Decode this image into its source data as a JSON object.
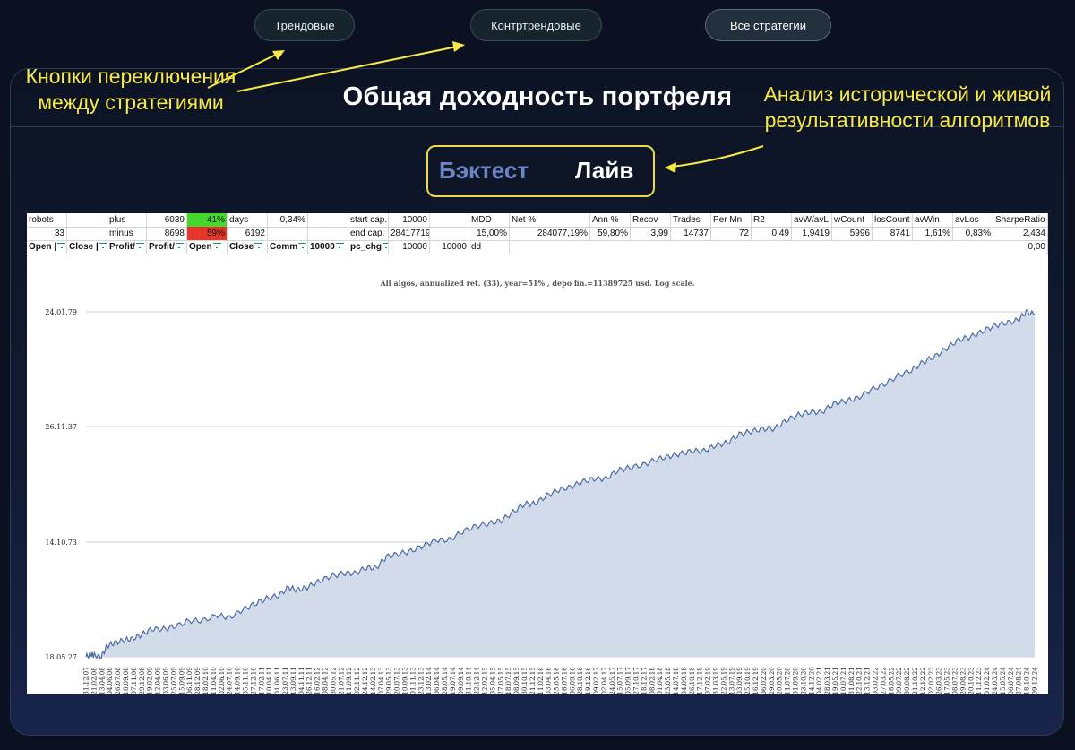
{
  "nav": {
    "trend_label": "Трендовые",
    "counter_label": "Контртрендовые",
    "all_label": "Все стратегии"
  },
  "panel": {
    "title": "Общая доходность портфеля"
  },
  "annotations": {
    "left": "Кнопки переключения между стратегиями",
    "right": "Анализ исторической и живой результативности алгоритмов"
  },
  "mode": {
    "backtest_label": "Бэктест",
    "live_label": "Лайв"
  },
  "colors": {
    "accent_yellow": "#f7e84a",
    "fill": "#d2dbea",
    "line": "#4c6ba6",
    "green": "#46d62e",
    "red": "#e5362a"
  },
  "sheet": {
    "row1": {
      "robots": "robots",
      "plus": "plus",
      "plus_count": "6039",
      "plus_pct": "41%",
      "days": "days",
      "days_pct": "0,34%",
      "start_cap": "start cap.",
      "start_cap_val": "10000",
      "mdd": "MDD",
      "net": "Net %",
      "ann": "Ann %",
      "recov": "Recov",
      "trades": "Trades",
      "per_mn": "Per Mn",
      "r2": "R2",
      "avw_avl": "avW/avL",
      "wcount": "wCount",
      "loscount": "losCount",
      "avwin": "avWin",
      "avlos": "avLos",
      "sharpe": "SharpeRatio"
    },
    "row2": {
      "robots_val": "33",
      "minus": "minus",
      "minus_count": "8698",
      "minus_pct": "59%",
      "days_val": "6192",
      "end_cap": "end cap.",
      "end_cap_val": "28417719",
      "mdd_val": "15,00%",
      "net_val": "284077,19%",
      "ann_val": "59,80%",
      "recov_val": "3,99",
      "trades_val": "14737",
      "per_mn_val": "72",
      "r2_val": "0,49",
      "avw_avl_val": "1,9419",
      "wcount_val": "5996",
      "loscount_val": "8741",
      "avwin_val": "1,61%",
      "avlos_val": "0,83%",
      "sharpe_val": "2,434"
    },
    "row3": {
      "open1": "Open |",
      "close1": "Close |",
      "profit1": "Profit/",
      "profit2": "Profit/",
      "open2": "Open",
      "close2": "Close",
      "comm": "Comm",
      "ten_k": "10000",
      "pc_chg": "pc_chg",
      "v1": "10000",
      "v2": "10000",
      "dd": "dd",
      "last": "0,00"
    }
  },
  "chart_data": {
    "type": "area",
    "title": "All algos, annualized ret. (33), year=51% , depo fin.=11389725 usd. Log scale.",
    "y_tick_labels": [
      "24.01.79",
      "26.11.37",
      "14.10.73",
      "18.05.27"
    ],
    "x_tick_labels": [
      "31.12.07",
      "21.02.08",
      "13.04.08",
      "04.06.08",
      "26.07.08",
      "16.09.08",
      "07.11.08",
      "29.12.08",
      "19.02.09",
      "12.04.09",
      "03.06.09",
      "25.07.09",
      "15.09.09",
      "06.11.09",
      "28.12.09",
      "18.02.10",
      "11.04.10",
      "02.06.10",
      "24.07.10",
      "14.09.10",
      "05.11.10",
      "27.12.10",
      "17.02.11",
      "10.04.11",
      "01.06.11",
      "23.07.11",
      "13.09.11",
      "04.11.11",
      "26.12.11",
      "16.02.12",
      "08.04.12",
      "30.05.12",
      "21.07.12",
      "11.09.12",
      "02.11.12",
      "24.12.12",
      "14.02.13",
      "07.04.13",
      "29.05.13",
      "20.07.13",
      "10.09.13",
      "01.11.13",
      "23.12.13",
      "13.02.14",
      "06.04.14",
      "28.05.14",
      "19.07.14",
      "09.09.14",
      "31.10.14",
      "22.12.14",
      "12.02.15",
      "05.04.15",
      "27.05.15",
      "18.07.15",
      "08.09.15",
      "30.10.15",
      "21.12.15",
      "11.02.16",
      "03.04.16",
      "25.05.16",
      "16.07.16",
      "06.09.16",
      "28.10.16",
      "19.12.16",
      "09.02.17",
      "02.04.17",
      "24.05.17",
      "15.07.17",
      "05.09.17",
      "27.10.17",
      "18.12.17",
      "08.02.18",
      "01.04.18",
      "23.05.18",
      "14.07.18",
      "04.09.18",
      "26.10.18",
      "17.12.18",
      "07.02.19",
      "31.03.19",
      "22.05.19",
      "13.07.19",
      "03.09.19",
      "25.10.19",
      "16.12.19",
      "06.02.20",
      "29.03.20",
      "20.05.20",
      "11.07.20",
      "01.09.20",
      "23.10.20",
      "14.12.20",
      "04.02.21",
      "28.03.21",
      "19.05.21",
      "10.07.21",
      "31.08.21",
      "22.10.21",
      "13.12.21",
      "03.02.22",
      "27.03.22",
      "18.05.22",
      "09.07.22",
      "30.08.22",
      "21.10.22",
      "12.12.22",
      "02.02.23",
      "26.03.23",
      "17.05.23",
      "08.07.23",
      "29.08.23",
      "20.10.23",
      "11.12.23",
      "01.02.24",
      "24.03.24",
      "15.05.24",
      "06.07.24",
      "27.08.24",
      "18.10.24",
      "09.12.24"
    ],
    "series": [
      {
        "x": [
          0,
          6,
          10,
          18,
          25,
          34,
          45,
          55,
          66,
          78,
          92,
          106,
          122,
          138,
          156,
          170,
          186,
          200,
          214,
          228,
          240,
          250,
          262,
          275,
          290,
          305,
          318,
          332,
          344,
          356,
          370,
          385,
          400,
          415,
          430,
          446,
          462,
          478,
          492,
          506,
          520,
          532,
          546,
          560,
          574,
          588,
          602,
          616,
          630,
          644,
          660,
          676,
          690,
          704,
          718,
          732,
          746,
          760,
          774,
          788,
          802,
          816,
          830,
          844,
          858,
          872,
          886,
          900,
          914,
          930,
          946,
          962,
          978,
          992,
          1006,
          1020,
          1034,
          1048,
          1062,
          1076,
          1090,
          1104,
          1114,
          1124
        ],
        "y": [
          0,
          0.01,
          0.005,
          0.0,
          0.04,
          0.05,
          0.06,
          0.065,
          0.08,
          0.1,
          0.1,
          0.11,
          0.13,
          0.13,
          0.15,
          0.14,
          0.17,
          0.19,
          0.21,
          0.22,
          0.25,
          0.24,
          0.25,
          0.27,
          0.29,
          0.3,
          0.3,
          0.32,
          0.32,
          0.36,
          0.37,
          0.38,
          0.4,
          0.42,
          0.42,
          0.45,
          0.47,
          0.48,
          0.49,
          0.52,
          0.55,
          0.55,
          0.58,
          0.6,
          0.61,
          0.63,
          0.64,
          0.64,
          0.67,
          0.68,
          0.69,
          0.71,
          0.72,
          0.73,
          0.74,
          0.74,
          0.76,
          0.77,
          0.8,
          0.81,
          0.82,
          0.82,
          0.85,
          0.87,
          0.88,
          0.88,
          0.91,
          0.92,
          0.93,
          0.96,
          0.98,
          1.01,
          1.03,
          1.06,
          1.08,
          1.11,
          1.14,
          1.15,
          1.17,
          1.19,
          1.2,
          1.21,
          1.24,
          1.23
        ]
      }
    ],
    "y_scale": "log",
    "grid": true
  }
}
